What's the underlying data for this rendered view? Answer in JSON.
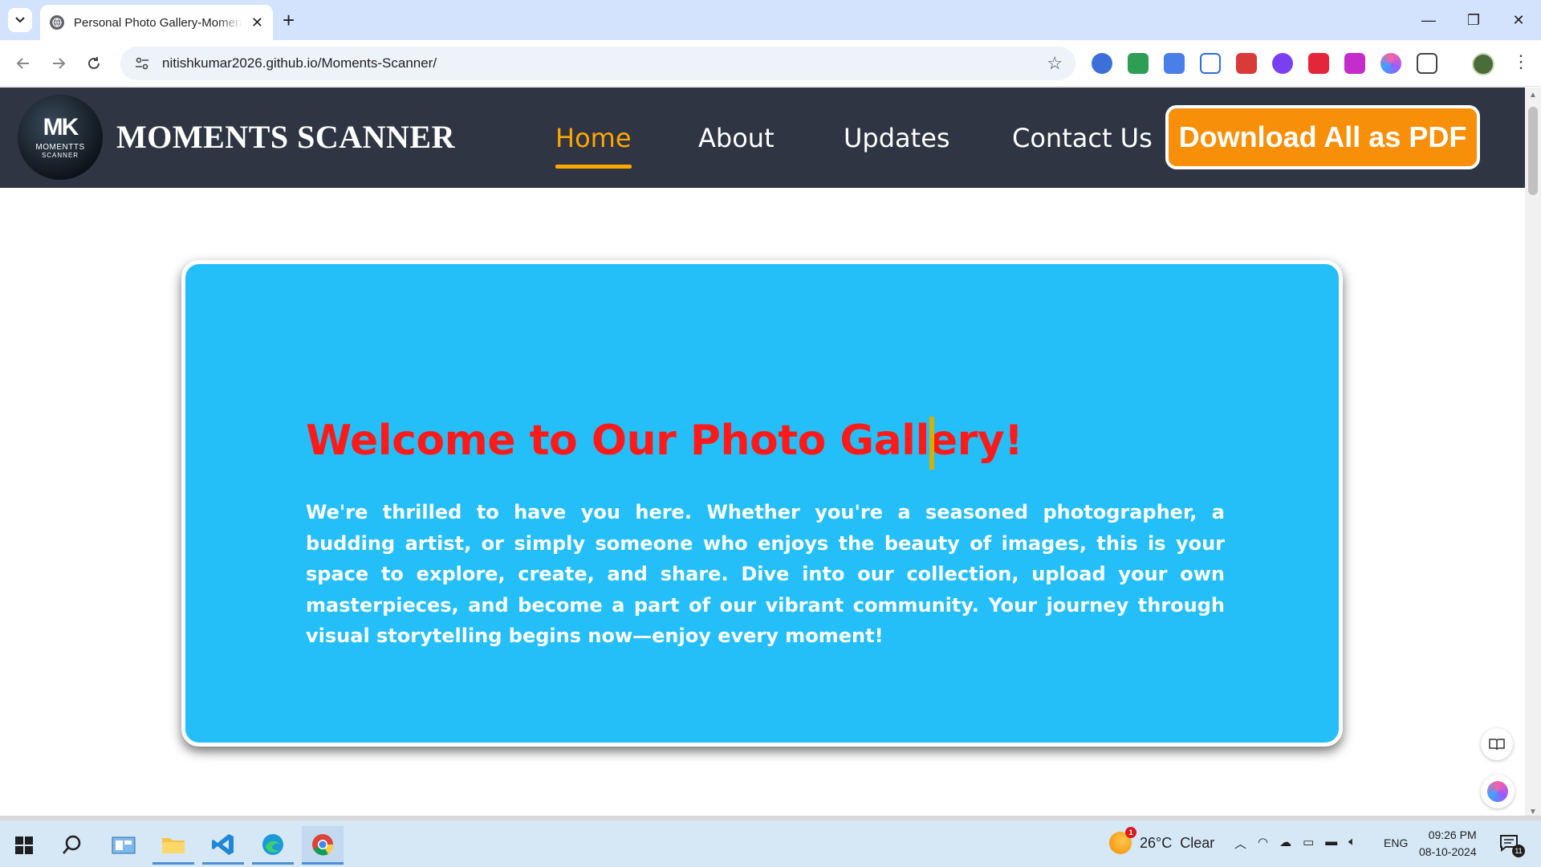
{
  "browser": {
    "tab_title": "Personal Photo Gallery-Moments Scanner",
    "tab_close": "✕",
    "new_tab": "+",
    "url": "nitishkumar2026.github.io/Moments-Scanner/",
    "window": {
      "minimize": "—",
      "restore": "❐",
      "close": "✕"
    },
    "extensions": [
      {
        "name": "ext-1",
        "color": "#3d6fd8"
      },
      {
        "name": "ext-2",
        "color": "#2e9e57"
      },
      {
        "name": "google-translate",
        "color": "#4a7ee8"
      },
      {
        "name": "ext-4",
        "color": "#2a6fd8"
      },
      {
        "name": "ext-5",
        "color": "#d93a3a"
      },
      {
        "name": "ext-6",
        "color": "#7b3ff2"
      },
      {
        "name": "ext-7",
        "color": "#e3263a"
      },
      {
        "name": "ext-8",
        "color": "#c42ccc"
      },
      {
        "name": "ext-9",
        "color": "#9b59ff"
      }
    ]
  },
  "site": {
    "logo": {
      "mark": "MK",
      "line1": "MOMENTTS",
      "line2": "SCANNER"
    },
    "name": "MOMENTS SCANNER",
    "nav": {
      "home": "Home",
      "about": "About",
      "updates": "Updates",
      "contact": "Contact Us"
    },
    "download_label": "Download All as PDF",
    "accent_color": "#ffa600",
    "header_color": "#2f3542"
  },
  "hero": {
    "title": "Welcome to Our Photo Gallery!",
    "body": "We're thrilled to have you here. Whether you're a seasoned photographer, a budding artist, or simply someone who enjoys the beauty of images, this is your space to explore, create, and share. Dive into our collection, upload your own masterpieces, and become a part of our vibrant community. Your journey through visual storytelling begins now—enjoy every moment!",
    "background": "#24bff9",
    "title_color": "#ff1a1a"
  },
  "taskbar": {
    "weather_temp": "26°C",
    "weather_desc": "Clear",
    "weather_alert": "1",
    "lang": "ENG",
    "time": "09:26 PM",
    "date": "08-10-2024",
    "notif_count": "11"
  }
}
